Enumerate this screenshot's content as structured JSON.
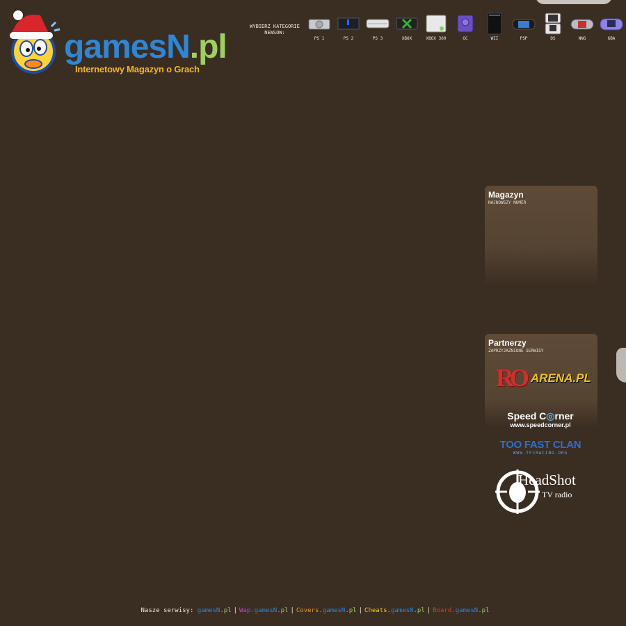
{
  "logo": {
    "word_main": "gamesN",
    "word_tld": ".pl",
    "tagline": "Internetowy Magazyn o Grach"
  },
  "categories": {
    "label_line1": "WYBIERZ KATEGORIE",
    "label_line2": "NEWSOW:",
    "items": [
      {
        "name": "PS 1",
        "icon": "ps1-console-icon"
      },
      {
        "name": "PS 2",
        "icon": "ps2-console-icon"
      },
      {
        "name": "PS 3",
        "icon": "ps3-console-icon"
      },
      {
        "name": "XBOX",
        "icon": "xbox-console-icon"
      },
      {
        "name": "XBOX 360",
        "icon": "xbox360-console-icon"
      },
      {
        "name": "GC",
        "icon": "gamecube-console-icon"
      },
      {
        "name": "WII",
        "icon": "wii-console-icon"
      },
      {
        "name": "PSP",
        "icon": "psp-console-icon"
      },
      {
        "name": "DS",
        "icon": "ds-console-icon"
      },
      {
        "name": "NNG",
        "icon": "ngage-console-icon"
      },
      {
        "name": "GBA",
        "icon": "gba-console-icon"
      }
    ]
  },
  "magazyn": {
    "title": "Magazyn",
    "subtitle": "NAJNOWSZY NUMER"
  },
  "partnerzy": {
    "title": "Partnerzy",
    "subtitle": "ZAPRZYJAZNIONE SERWISY",
    "arena_ro": "RO",
    "arena_text": "ARENA.PL",
    "speed_a": "Speed C",
    "speed_b": "rner",
    "speed_url": "www.speedcorner.pl",
    "tfc_title": "TOO FAST CLAN",
    "tfc_url": "WWW.TFCRACING.ORG",
    "headshot_title": "HeadShot",
    "headshot_sub": "TV radio"
  },
  "footer": {
    "label": "Nasze serwisy:",
    "links": [
      {
        "prefix": "",
        "site": "gamesN",
        "tld": ".pl",
        "prefix_color": "#ffffff"
      },
      {
        "prefix": "Wap.",
        "site": "gamesN",
        "tld": ".pl",
        "prefix_color": "#b04ad6"
      },
      {
        "prefix": "Covers.",
        "site": "gamesN",
        "tld": ".pl",
        "prefix_color": "#f39c1a"
      },
      {
        "prefix": "Cheats.",
        "site": "gamesN",
        "tld": ".pl",
        "prefix_color": "#f0d21a"
      },
      {
        "prefix": "Board.",
        "site": "gamesN",
        "tld": ".pl",
        "prefix_color": "#e03a2a"
      }
    ],
    "separator": "|"
  },
  "colors": {
    "background": "#3a2d22",
    "brand_blue": "#2f86d6",
    "brand_green": "#9ed05c",
    "tagline_yellow": "#f3b728",
    "panel": "#5e4a37"
  }
}
